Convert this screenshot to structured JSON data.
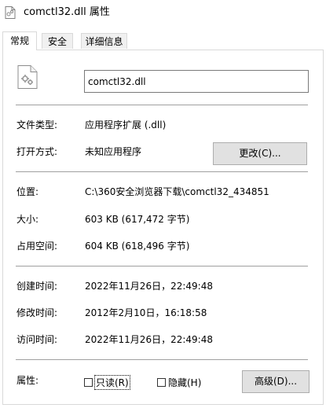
{
  "window": {
    "title": "comctl32.dll 属性"
  },
  "tabs": [
    {
      "label": "常规",
      "active": true
    },
    {
      "label": "安全",
      "active": false
    },
    {
      "label": "详细信息",
      "active": false
    }
  ],
  "file": {
    "name": "comctl32.dll"
  },
  "general": {
    "type_label": "文件类型:",
    "type_value": "应用程序扩展 (.dll)",
    "open_with_label": "打开方式:",
    "open_with_value": "未知应用程序",
    "change_button": "更改(C)...",
    "location_label": "位置:",
    "location_value": "C:\\360安全浏览器下载\\comctl32_434851",
    "size_label": "大小:",
    "size_value": "603 KB (617,472 字节)",
    "size_on_disk_label": "占用空间:",
    "size_on_disk_value": "604 KB (618,496 字节)",
    "created_label": "创建时间:",
    "created_value": "2022年11月26日，22:49:48",
    "modified_label": "修改时间:",
    "modified_value": "2012年2月10日，16:18:58",
    "accessed_label": "访问时间:",
    "accessed_value": "2022年11月26日，22:49:48",
    "attributes_label": "属性:",
    "readonly_label": "只读(R)",
    "readonly_checked": false,
    "hidden_label": "隐藏(H)",
    "hidden_checked": false,
    "advanced_button": "高级(D)..."
  },
  "icons": {
    "title": "dll-file-icon",
    "file": "dll-file-gear-icon"
  }
}
